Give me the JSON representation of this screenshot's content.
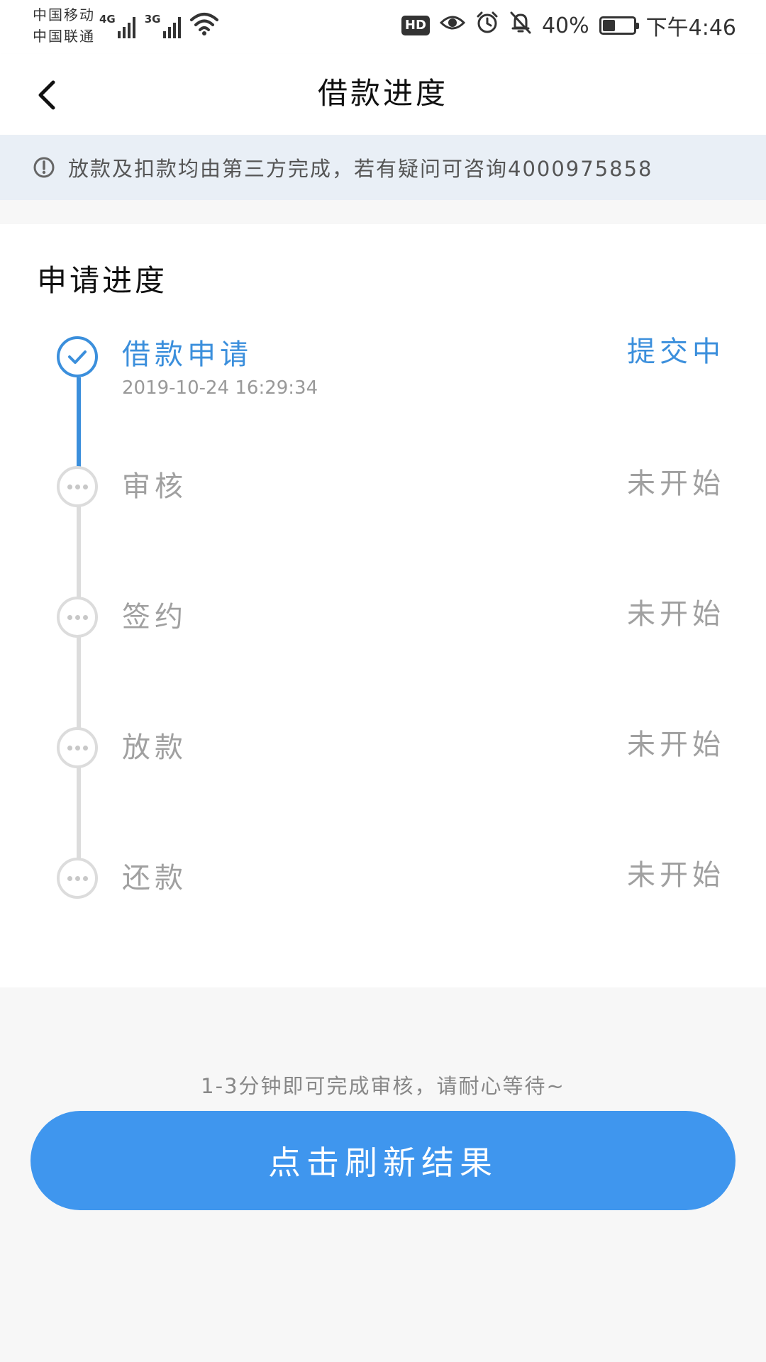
{
  "status_bar": {
    "carrier_1": "中国移动",
    "carrier_2": "中国联通",
    "net_1": "4G",
    "net_2": "3G",
    "hd": "HD",
    "battery_percent": "40%",
    "battery_level": 0.4,
    "time": "下午4:46"
  },
  "header": {
    "title": "借款进度"
  },
  "notice": {
    "text": "放款及扣款均由第三方完成，若有疑问可咨询4000975858"
  },
  "progress": {
    "section_title": "申请进度",
    "steps": [
      {
        "name": "借款申请",
        "time": "2019-10-24 16:29:34",
        "status": "提交中",
        "state": "done"
      },
      {
        "name": "审核",
        "status": "未开始",
        "state": "pending"
      },
      {
        "name": "签约",
        "status": "未开始",
        "state": "pending"
      },
      {
        "name": "放款",
        "status": "未开始",
        "state": "pending"
      },
      {
        "name": "还款",
        "status": "未开始",
        "state": "pending"
      }
    ]
  },
  "footer": {
    "hint": "1-3分钟即可完成审核，请耐心等待~",
    "refresh_label": "点击刷新结果"
  },
  "colors": {
    "accent": "#3b8fdc",
    "button": "#3f96ee",
    "pending": "#a0a0a0",
    "notice_bg": "#e9eff6"
  },
  "icons": {
    "back": "chevron-left-icon",
    "notice": "exclamation-circle-icon",
    "done": "check-circle-icon",
    "pending": "ellipsis-circle-icon"
  }
}
